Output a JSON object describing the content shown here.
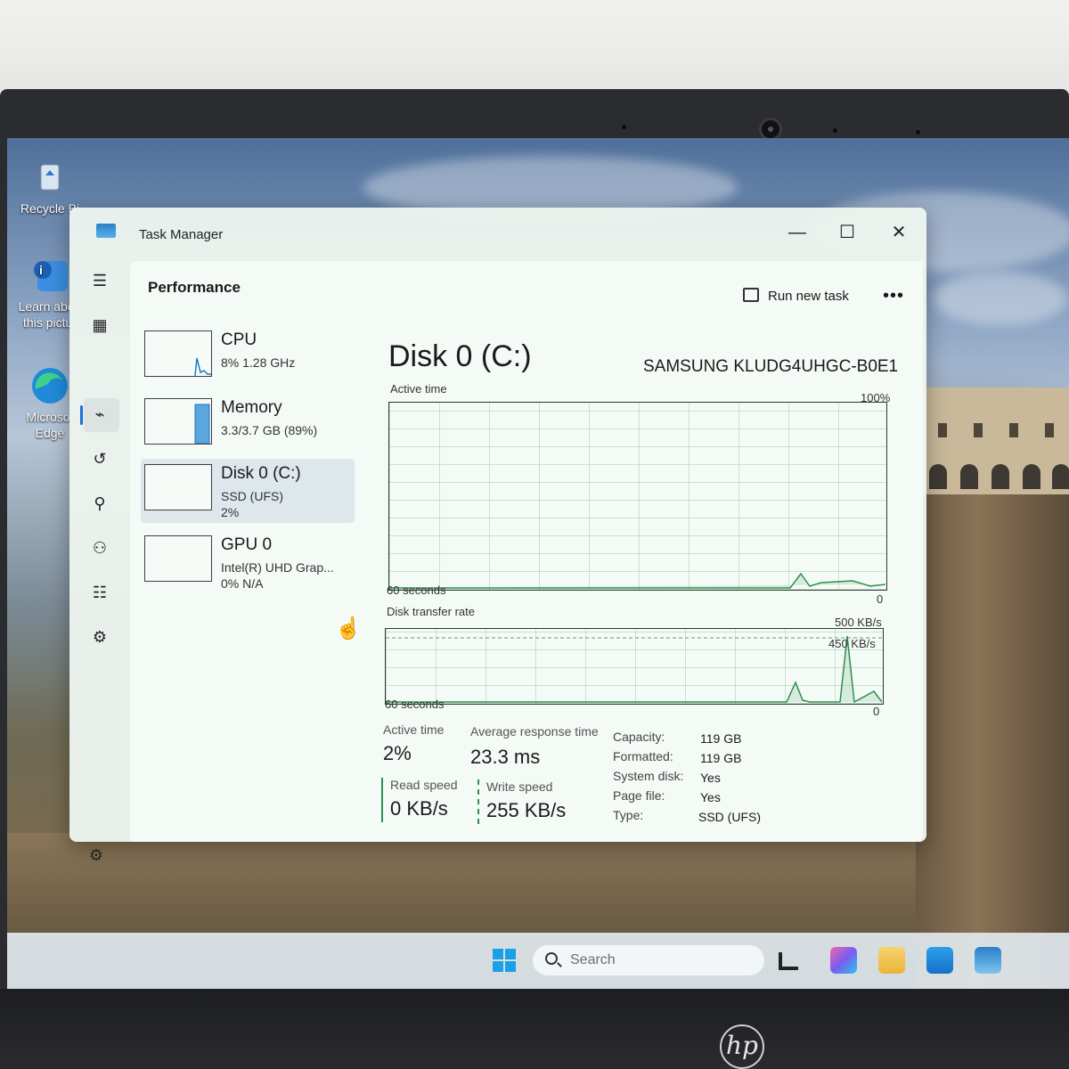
{
  "desktop": {
    "icons": [
      {
        "label": "Recycle Bi",
        "icon": "recycle-bin-icon"
      },
      {
        "label": "Learn abou this pictur",
        "icon": "info-picture-icon"
      },
      {
        "label": "Microsof Edge",
        "icon": "edge-icon"
      }
    ]
  },
  "window": {
    "title": "Task Manager",
    "minimize": "—",
    "maximize": "☐",
    "close": "✕"
  },
  "nav": {
    "icons": [
      "menu-icon",
      "processes-icon",
      "performance-icon",
      "app-history-icon",
      "startup-icon",
      "users-icon",
      "details-icon",
      "services-icon",
      "settings-icon"
    ]
  },
  "header": {
    "title": "Performance",
    "run_task": "Run new task",
    "more": "•••"
  },
  "devices": [
    {
      "name": "CPU",
      "sub1": "8%  1.28 GHz",
      "sub2": ""
    },
    {
      "name": "Memory",
      "sub1": "3.3/3.7 GB (89%)",
      "sub2": ""
    },
    {
      "name": "Disk 0 (C:)",
      "sub1": "SSD (UFS)",
      "sub2": "2%"
    },
    {
      "name": "GPU 0",
      "sub1": "Intel(R) UHD Grap...",
      "sub2": "0%  N/A"
    }
  ],
  "detail": {
    "title": "Disk 0 (C:)",
    "model": "SAMSUNG KLUDG4UHGC-B0E1",
    "active_time_label": "Active time",
    "active_max": "100%",
    "seconds_label": "60 seconds",
    "zero": "0",
    "transfer_label": "Disk transfer rate",
    "transfer_max": "500 KB/s",
    "transfer_mark": "450 KB/s",
    "seconds_label2": "60 seconds",
    "zero2": "0"
  },
  "stats": {
    "active_time": {
      "label": "Active time",
      "value": "2%"
    },
    "avg_response": {
      "label": "Average response time",
      "value": "23.3 ms"
    },
    "read_speed": {
      "label": "Read speed",
      "value": "0 KB/s"
    },
    "write_speed": {
      "label": "Write speed",
      "value": "255 KB/s"
    }
  },
  "properties": [
    {
      "key": "Capacity:",
      "value": "119 GB"
    },
    {
      "key": "Formatted:",
      "value": "119 GB"
    },
    {
      "key": "System disk:",
      "value": "Yes"
    },
    {
      "key": "Page file:",
      "value": "Yes"
    },
    {
      "key": "Type:",
      "value": "SSD (UFS)"
    }
  ],
  "taskbar": {
    "search_placeholder": "Search"
  },
  "brand": {
    "logo_text": "hp"
  },
  "colors": {
    "graph_line": "#2f8f4e",
    "accent": "#1f6fd6"
  }
}
